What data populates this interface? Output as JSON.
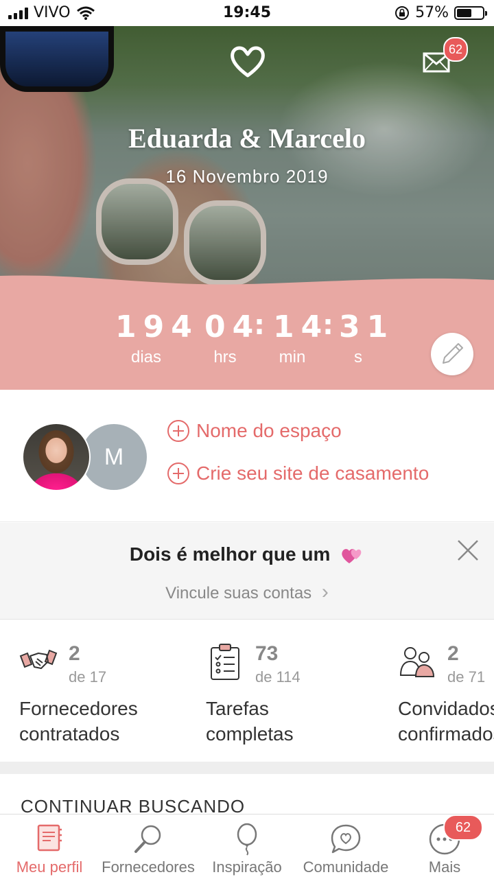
{
  "status_bar": {
    "carrier": "VIVO",
    "time": "19:45",
    "battery": "57%",
    "battery_level": 0.57
  },
  "header": {
    "couple_names": "Eduarda & Marcelo",
    "wedding_date": "16 Novembro 2019",
    "messages_badge": "62"
  },
  "countdown": {
    "days": "194",
    "days_label": "dias",
    "hours": "04",
    "hours_label": "hrs",
    "minutes": "14",
    "minutes_label": "min",
    "seconds": "31",
    "seconds_label": "s"
  },
  "profile": {
    "partner_initial": "M",
    "links": [
      "Nome do espaço",
      "Crie seu site de casamento"
    ]
  },
  "promo": {
    "title": "Dois é melhor que um",
    "link": "Vincule suas contas",
    "link_arrow": "›"
  },
  "stats": [
    {
      "count": "2",
      "of": "de 17",
      "label": "Fornecedores\ncontratados",
      "icon": "handshake-icon"
    },
    {
      "count": "73",
      "of": "de 114",
      "label": "Tarefas\ncompletas",
      "icon": "checklist-icon"
    },
    {
      "count": "2",
      "of": "de 71",
      "label": "Convidados\nconfirmados",
      "icon": "guests-icon"
    }
  ],
  "section": {
    "title": "CONTINUAR BUSCANDO"
  },
  "tabbar": {
    "items": [
      {
        "label": "Meu perfil",
        "icon": "notebook-icon",
        "active": true
      },
      {
        "label": "Fornecedores",
        "icon": "magnifier-icon"
      },
      {
        "label": "Inspiração",
        "icon": "balloon-icon"
      },
      {
        "label": "Comunidade",
        "icon": "chat-heart-icon"
      },
      {
        "label": "Mais",
        "icon": "more-icon"
      }
    ],
    "more_badge": "62"
  },
  "colors": {
    "accent": "#e46a6a",
    "countdown_bg": "#e8a8a3",
    "badge": "#e85a5a"
  }
}
